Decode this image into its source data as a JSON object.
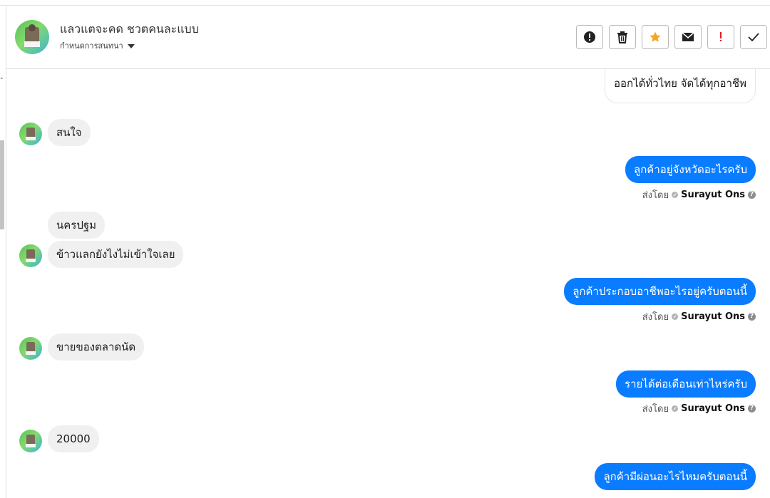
{
  "header": {
    "contact_name": "แลวแตจะคด ชวตคนละแบบ",
    "conversation_setting": "กำหนดการสนทนา"
  },
  "actions": [
    {
      "name": "report-button",
      "icon": "exclamation-circle-icon"
    },
    {
      "name": "delete-button",
      "icon": "trash-icon"
    },
    {
      "name": "star-button",
      "icon": "star-icon",
      "color": "#f5a623"
    },
    {
      "name": "mark-unread-button",
      "icon": "envelope-icon"
    },
    {
      "name": "spam-button",
      "icon": "exclamation-icon",
      "color": "#e02020"
    },
    {
      "name": "done-button",
      "icon": "check-icon"
    }
  ],
  "messages": {
    "m0": "ออกได้ทั่วไทย จัดได้ทุกอาชีพ",
    "m1": "สนใจ",
    "m2": "ลูกค้าอยู่จังหวัดอะไรครับ",
    "m3": "นครปฐม",
    "m4": "ข้าวแลกยังไงไม่เข้าใจเลย",
    "m5": "ลูกค้าประกอบอาชีพอะไรอยู่ครับตอนนี้",
    "m6": "ขายของตลาดนัด",
    "m7": "รายได้ต่อเดือนเท่าไหร่ครับ",
    "m8": "20000",
    "m9": "ลูกค้ามีผ่อนอะไรไหมครับตอนนี้"
  },
  "sent_by": {
    "label": "ส่งโดย",
    "agent": "Surayut Ons"
  },
  "colors": {
    "outgoing_bubble": "#0a7cff",
    "incoming_bubble": "#f0f0f0"
  }
}
